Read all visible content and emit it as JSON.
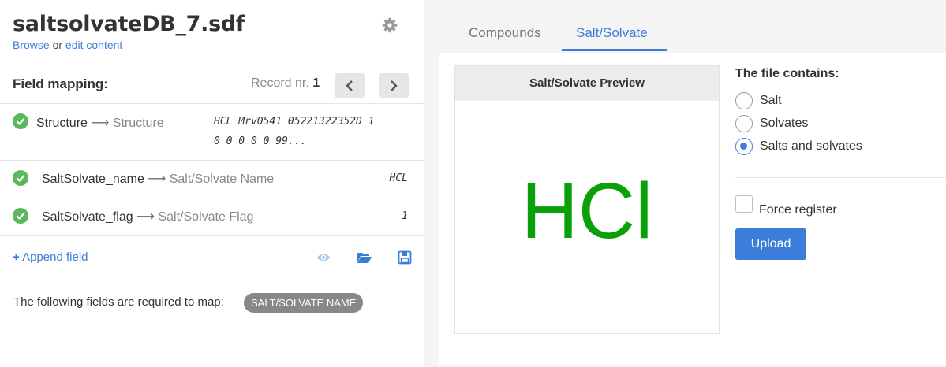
{
  "file": {
    "title": "saltsolvateDB_7.sdf",
    "browse_link": "Browse",
    "or_text": " or ",
    "edit_link": "edit content"
  },
  "field_mapping": {
    "title": "Field mapping:",
    "record_label": "Record nr. ",
    "record_number": "1",
    "rows": [
      {
        "source": "Structure",
        "arrow": "⟶",
        "target": "Structure",
        "value_line1": "HCL Mrv0541 05221322352D 1",
        "value_line2": "0 0 0 0 0 99...",
        "status": "ok"
      },
      {
        "source": "SaltSolvate_name",
        "arrow": "⟶",
        "target": "Salt/Solvate Name",
        "value_line1": "HCL",
        "status": "ok"
      },
      {
        "source": "SaltSolvate_flag",
        "arrow": "⟶",
        "target": "Salt/Solvate Flag",
        "value_line1": "1",
        "status": "ok"
      }
    ]
  },
  "toolbar": {
    "append_icon": "+",
    "append_label": "Append field",
    "icons": [
      "eye-icon",
      "folder-open-icon",
      "save-icon"
    ]
  },
  "required": {
    "text": "The following fields are required to map:",
    "badge": "SALT/SOLVATE NAME"
  },
  "tabs": [
    {
      "label": "Compounds",
      "active": false
    },
    {
      "label": "Salt/Solvate",
      "active": true
    }
  ],
  "preview": {
    "title": "Salt/Solvate Preview",
    "formula": "HCl",
    "formula_color": "#0aa00a"
  },
  "options": {
    "title": "The file contains:",
    "radios": [
      {
        "label": "Salt",
        "checked": false
      },
      {
        "label": "Solvates",
        "checked": false
      },
      {
        "label": "Salts and solvates",
        "checked": true
      }
    ],
    "force_register_label": "Force register",
    "force_register_checked": false,
    "upload_label": "Upload"
  },
  "colors": {
    "accent": "#3b7dd8",
    "success": "#5cb85c",
    "badge_bg": "#888888"
  }
}
